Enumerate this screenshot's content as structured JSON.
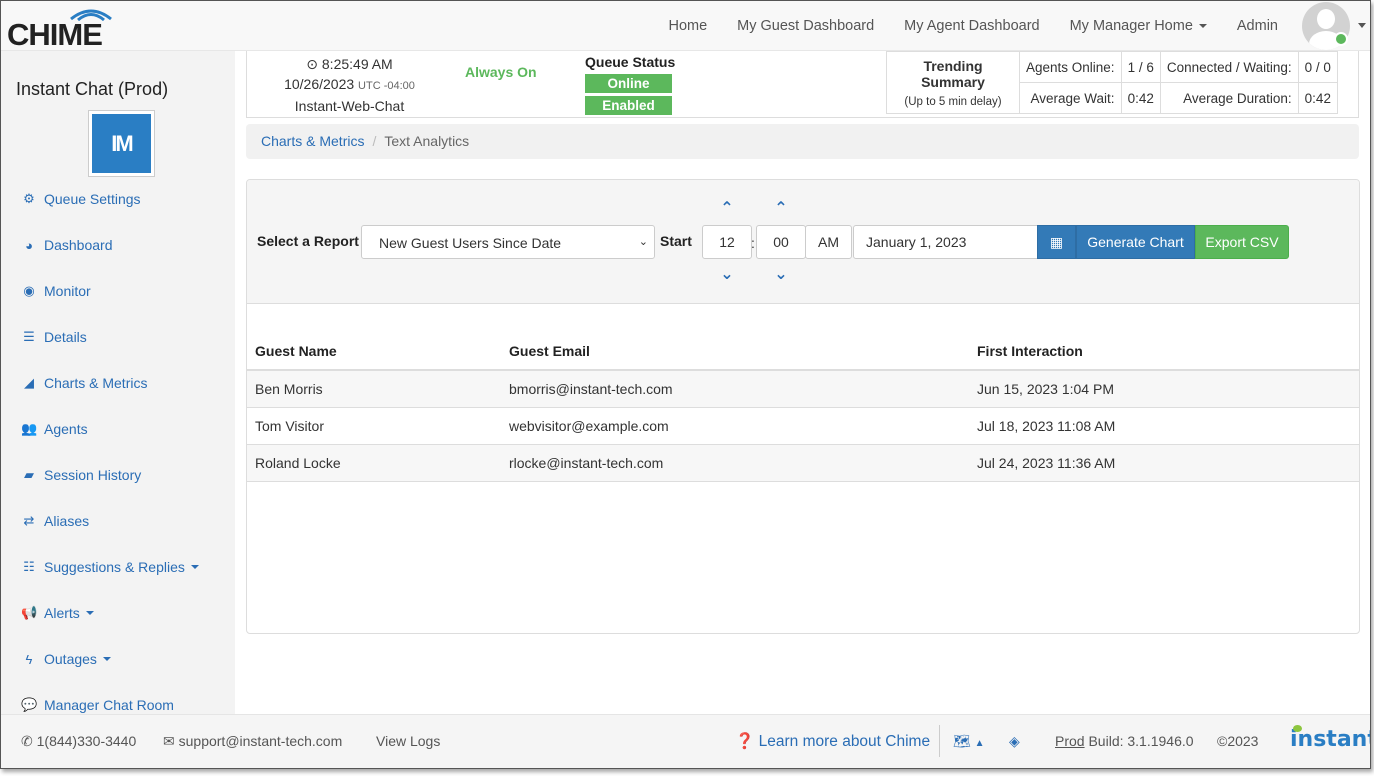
{
  "app": {
    "logo_text": "CHIME"
  },
  "nav": {
    "home": "Home",
    "guest_dashboard": "My Guest Dashboard",
    "agent_dashboard": "My Agent Dashboard",
    "manager_home": "My Manager Home",
    "admin": "Admin"
  },
  "sidebar": {
    "title": "Instant Chat (Prod)",
    "logo_initials": "IM",
    "items": [
      {
        "label": "Queue Settings",
        "icon": "gear-icon"
      },
      {
        "label": "Dashboard",
        "icon": "dashboard-icon"
      },
      {
        "label": "Monitor",
        "icon": "eye-icon"
      },
      {
        "label": "Details",
        "icon": "list-icon"
      },
      {
        "label": "Charts & Metrics",
        "icon": "area-chart-icon"
      },
      {
        "label": "Agents",
        "icon": "users-icon"
      },
      {
        "label": "Session History",
        "icon": "book-icon"
      },
      {
        "label": "Aliases",
        "icon": "exchange-icon"
      },
      {
        "label": "Suggestions & Replies",
        "icon": "list-ol-icon"
      },
      {
        "label": "Alerts",
        "icon": "bullhorn-icon"
      },
      {
        "label": "Outages",
        "icon": "bolt-icon"
      },
      {
        "label": "Manager Chat Room",
        "icon": "comments-icon"
      }
    ]
  },
  "status": {
    "time": "8:25:49 AM",
    "date": "10/26/2023",
    "tz": "UTC -04:00",
    "queue_name": "Instant-Web-Chat",
    "always_on": "Always On",
    "queue_status_label": "Queue Status",
    "online": "Online",
    "enabled": "Enabled",
    "trending_label": "Trending Summary",
    "trending_sub": "(Up to 5 min delay)",
    "agents_online_label": "Agents Online:",
    "agents_online_value": "1 / 6",
    "connected_label": "Connected / Waiting:",
    "connected_value": "0 / 0",
    "avg_wait_label": "Average Wait:",
    "avg_wait_value": "0:42",
    "avg_duration_label": "Average Duration:",
    "avg_duration_value": "0:42"
  },
  "breadcrumb": {
    "parent": "Charts & Metrics",
    "current": "Text Analytics"
  },
  "report": {
    "select_label": "Select a Report",
    "selected_report": "New Guest Users Since Date",
    "start_label": "Start",
    "hour": "12",
    "minute": "00",
    "ampm": "AM",
    "date": "January 1, 2023",
    "generate_label": "Generate Chart",
    "export_label": "Export CSV"
  },
  "table": {
    "headers": [
      "Guest Name",
      "Guest Email",
      "First Interaction"
    ],
    "rows": [
      [
        "Ben Morris",
        "bmorris@instant-tech.com",
        "Jun 15, 2023 1:04 PM"
      ],
      [
        "Tom Visitor",
        "webvisitor@example.com",
        "Jul 18, 2023 11:08 AM"
      ],
      [
        "Roland Locke",
        "rlocke@instant-tech.com",
        "Jul 24, 2023 11:36 AM"
      ]
    ]
  },
  "footer": {
    "phone": "1(844)330-3440",
    "email": "support@instant-tech.com",
    "view_logs": "View Logs",
    "learn_more": "Learn more about Chime",
    "env": "Prod",
    "build": "Build: 3.1.1946.0",
    "copyright": "©2023",
    "brand": "instant"
  },
  "colors": {
    "primary": "#337ab7",
    "success": "#5cb85c",
    "link": "#2a6db5"
  }
}
